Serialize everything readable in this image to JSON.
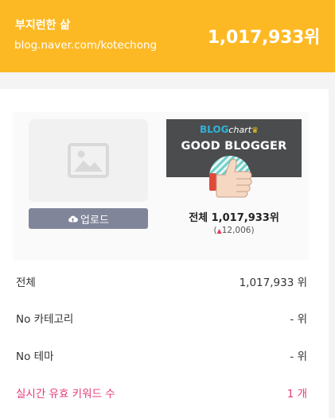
{
  "header": {
    "blog_name": "부지런한 삶",
    "blog_url": "blog.naver.com/kotechong",
    "rank": "1,017,933위"
  },
  "profile": {
    "image_icon": "image-placeholder-icon",
    "upload_icon": "cloud-upload-icon",
    "upload_label": "업로드"
  },
  "badge": {
    "logo_part1": "BLOG",
    "logo_part2": "chart",
    "label": "GOOD BLOGGER",
    "icon": "thumbs-up-icon",
    "total_rank": "전체 1,017,933위",
    "change_arrow": "▲",
    "change_value": "12,006",
    "change_open": "(",
    "change_close": ")"
  },
  "stats": [
    {
      "label": "전체",
      "value": "1,017,933 위"
    },
    {
      "label": "No 카테고리",
      "value": "- 위"
    },
    {
      "label": "No 테마",
      "value": "- 위"
    },
    {
      "label": "실시간 유효 키워드 수",
      "value": "1 개"
    }
  ],
  "colors": {
    "header_bg": "#fdb924",
    "upload_bg": "#808599",
    "badge_bg": "#4b4c4e",
    "highlight": "#e63a7b"
  }
}
